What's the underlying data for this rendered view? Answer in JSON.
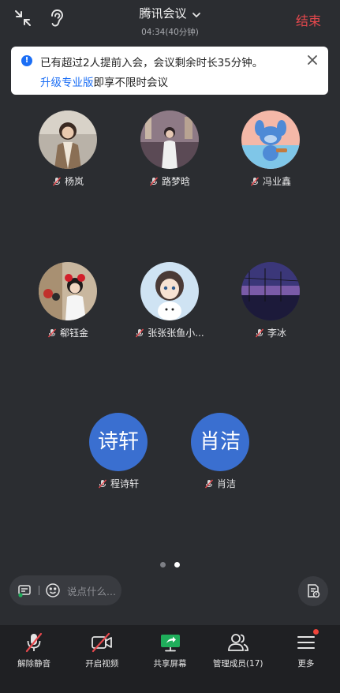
{
  "header": {
    "title": "腾讯会议",
    "duration": "04:34(40分钟)",
    "end_label": "结束"
  },
  "notice": {
    "line1": "已有超过2人提前入会，会议剩余时长35分钟。",
    "upgrade_link": "升级专业版",
    "line2_rest": "即享不限时会议"
  },
  "participants": [
    {
      "name": "杨岚",
      "avatar": "photo"
    },
    {
      "name": "路梦晗",
      "avatar": "photo"
    },
    {
      "name": "冯业鑫",
      "avatar": "photo"
    },
    {
      "name": "郗钰金",
      "avatar": "photo"
    },
    {
      "name": "张张张鱼小...",
      "avatar": "photo"
    },
    {
      "name": "李冰",
      "avatar": "photo"
    },
    {
      "name": "程诗轩",
      "avatar_text": "诗轩"
    },
    {
      "name": "肖洁",
      "avatar_text": "肖洁"
    }
  ],
  "pagination": {
    "pages": 2,
    "current": 2
  },
  "chat": {
    "placeholder": "说点什么..."
  },
  "toolbar": {
    "unmute": "解除静音",
    "video": "开启视频",
    "share": "共享屏幕",
    "members": "管理成员(17)",
    "more": "更多"
  },
  "colors": {
    "background": "#2b2d31",
    "toolbar": "#1f2023",
    "end": "#e5484d",
    "link": "#1b6ef5",
    "letter_avatar": "#3a6fd0",
    "share_green": "#1fae5b",
    "badge": "#f0443a"
  },
  "icons": {
    "collapse": "collapse-arrows-icon",
    "ear": "ear-icon",
    "mic_muted": "mic-muted-icon",
    "video_off": "camera-off-icon",
    "share": "screen-share-icon",
    "members": "users-icon",
    "more": "menu-icon"
  }
}
